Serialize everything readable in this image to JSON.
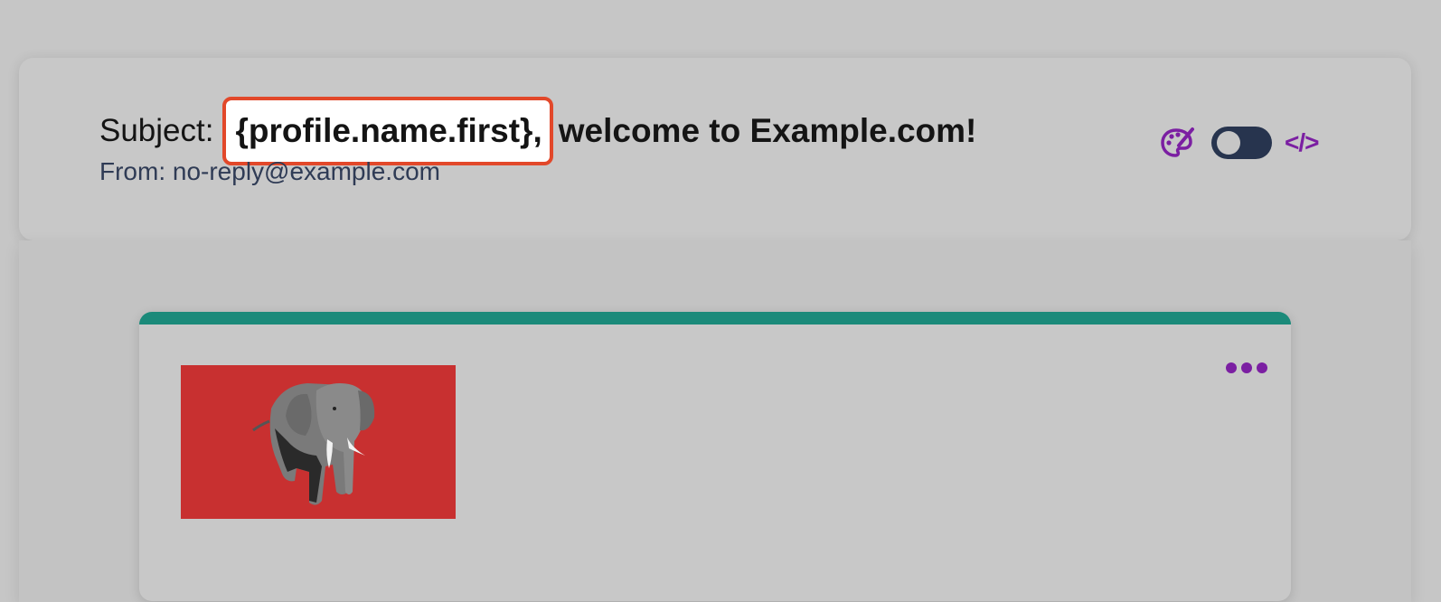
{
  "subject": {
    "label": "Subject:",
    "variable": "{profile.name.first},",
    "rest": "welcome to Example.com!"
  },
  "from": "From: no-reply@example.com",
  "toolbar": {
    "palette_icon": "palette-icon",
    "toggle_state": "off",
    "code_label": "</>"
  },
  "email": {
    "accent_color": "#1b8a7a",
    "logo_bg": "#c83030",
    "more_icon": "more-horizontal-icon"
  },
  "colors": {
    "highlight_border": "#e2482a",
    "icon_purple": "#7b1fa2",
    "toggle_bg": "#27344e"
  }
}
